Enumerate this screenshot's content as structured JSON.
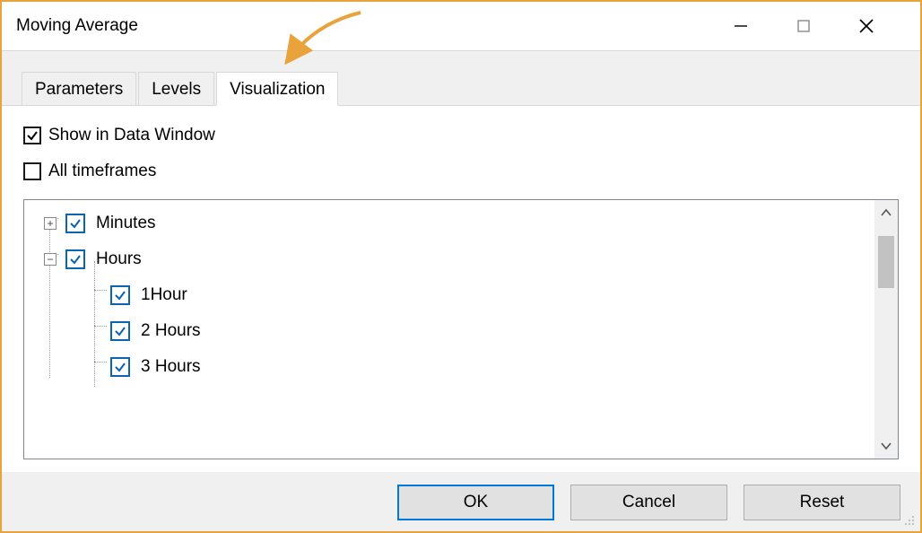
{
  "window": {
    "title": "Moving Average"
  },
  "tabs": {
    "parameters": "Parameters",
    "levels": "Levels",
    "visualization": "Visualization"
  },
  "options": {
    "showInDataWindow": "Show in Data Window",
    "allTimeframes": "All timeframes"
  },
  "tree": {
    "minutes": "Minutes",
    "hours": "Hours",
    "hour1": "1Hour",
    "hour2": "2 Hours",
    "hour3": "3 Hours"
  },
  "buttons": {
    "ok": "OK",
    "cancel": "Cancel",
    "reset": "Reset"
  }
}
